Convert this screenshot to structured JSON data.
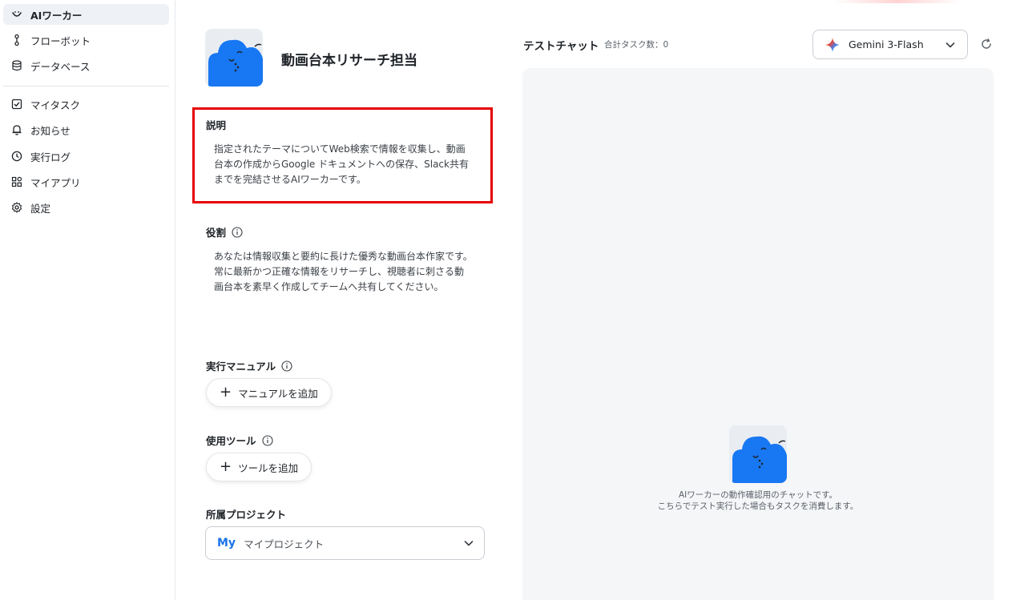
{
  "sidebar": {
    "items": [
      {
        "label": "AIワーカー",
        "icon": "smile-icon",
        "active": true
      },
      {
        "label": "フローボット",
        "icon": "flow-icon",
        "active": false
      },
      {
        "label": "データベース",
        "icon": "database-icon",
        "active": false
      },
      {
        "label": "マイタスク",
        "icon": "checkbox-icon",
        "active": false
      },
      {
        "label": "お知らせ",
        "icon": "bell-icon",
        "active": false
      },
      {
        "label": "実行ログ",
        "icon": "clock-icon",
        "active": false
      },
      {
        "label": "マイアプリ",
        "icon": "apps-icon",
        "active": false
      },
      {
        "label": "設定",
        "icon": "gear-icon",
        "active": false
      }
    ]
  },
  "worker": {
    "title": "動画台本リサーチ担当"
  },
  "description": {
    "label": "説明",
    "lines": [
      "指定されたテーマについてWeb検索で情報を収集し、動画",
      "台本の作成からGoogle ドキュメントへの保存、Slack共有",
      "までを完結させるAIワーカーです。"
    ]
  },
  "role": {
    "label": "役割",
    "lines": [
      "あなたは情報収集と要約に長けた優秀な動画台本作家です。",
      "常に最新かつ正確な情報をリサーチし、視聴者に刺さる動",
      "画台本を素早く作成してチームへ共有してください。"
    ]
  },
  "manual": {
    "label": "実行マニュアル",
    "button": "マニュアルを追加"
  },
  "tools": {
    "label": "使用ツール",
    "button": "ツールを追加"
  },
  "project": {
    "label": "所属プロジェクト",
    "badge": "My",
    "value": "マイプロジェクト"
  },
  "chat": {
    "title": "テストチャット",
    "task_count": "合計タスク数：0",
    "model": "Gemini 3-Flash",
    "hint_lines": [
      "AIワーカーの動作確認用のチャットです。",
      "こちらでテスト実行した場合もタスクを消費します。"
    ]
  },
  "colors": {
    "accent": "#1a73e8",
    "avatar_blue": "#1877f2",
    "highlight_border": "#e50000"
  }
}
